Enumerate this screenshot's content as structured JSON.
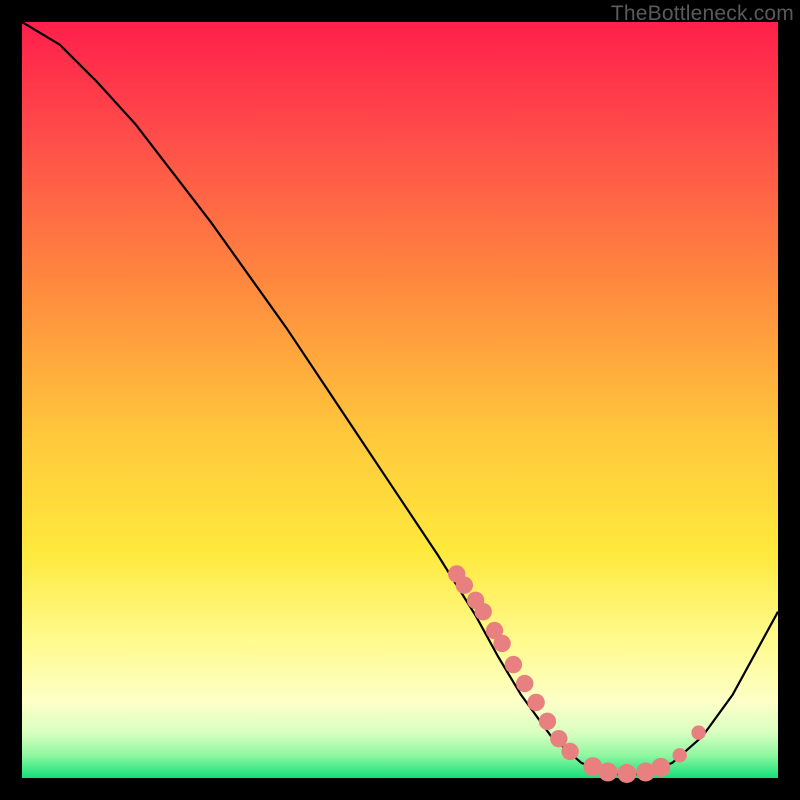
{
  "watermark": "TheBottleneck.com",
  "chart_data": {
    "type": "line",
    "title": "",
    "xlabel": "",
    "ylabel": "",
    "xlim": [
      0,
      100
    ],
    "ylim": [
      0,
      100
    ],
    "series": [
      {
        "name": "bottleneck-curve",
        "x_pct": [
          0,
          5,
          10,
          15,
          20,
          25,
          30,
          35,
          40,
          45,
          50,
          55,
          60,
          63,
          66,
          70,
          74,
          78,
          82,
          86,
          90,
          94,
          100
        ],
        "y_pct": [
          100,
          97,
          92,
          86.5,
          80,
          73.5,
          66.5,
          59.5,
          52,
          44.5,
          37,
          29.5,
          21.5,
          16,
          11,
          5.5,
          2,
          0.5,
          0.5,
          2,
          5.5,
          11,
          22
        ]
      }
    ],
    "marker_clusters": [
      {
        "name": "descending-slope-cluster",
        "points_xy_pct": [
          [
            57.5,
            27.0
          ],
          [
            58.5,
            25.5
          ],
          [
            60.0,
            23.5
          ],
          [
            61.0,
            22.0
          ],
          [
            62.5,
            19.5
          ],
          [
            63.5,
            17.8
          ],
          [
            65.0,
            15.0
          ],
          [
            66.5,
            12.5
          ],
          [
            68.0,
            10.0
          ],
          [
            69.5,
            7.5
          ],
          [
            71.0,
            5.2
          ],
          [
            72.5,
            3.5
          ]
        ],
        "radius_pct": 1.15,
        "color": "#e98080"
      },
      {
        "name": "bottom-valley-cluster",
        "points_xy_pct": [
          [
            75.5,
            1.5
          ],
          [
            77.5,
            0.8
          ],
          [
            80.0,
            0.6
          ],
          [
            82.5,
            0.8
          ],
          [
            84.5,
            1.4
          ]
        ],
        "radius_pct": 1.25,
        "color": "#e98080"
      },
      {
        "name": "rising-slope-cluster",
        "points_xy_pct": [
          [
            87.0,
            3.0
          ],
          [
            89.5,
            6.0
          ]
        ],
        "radius_pct": 0.95,
        "color": "#e98080"
      }
    ],
    "colors": {
      "curve": "#000000",
      "marker": "#e98080",
      "background_top": "#ff1f4b",
      "background_bottom": "#13e07a",
      "frame": "#000000"
    }
  }
}
